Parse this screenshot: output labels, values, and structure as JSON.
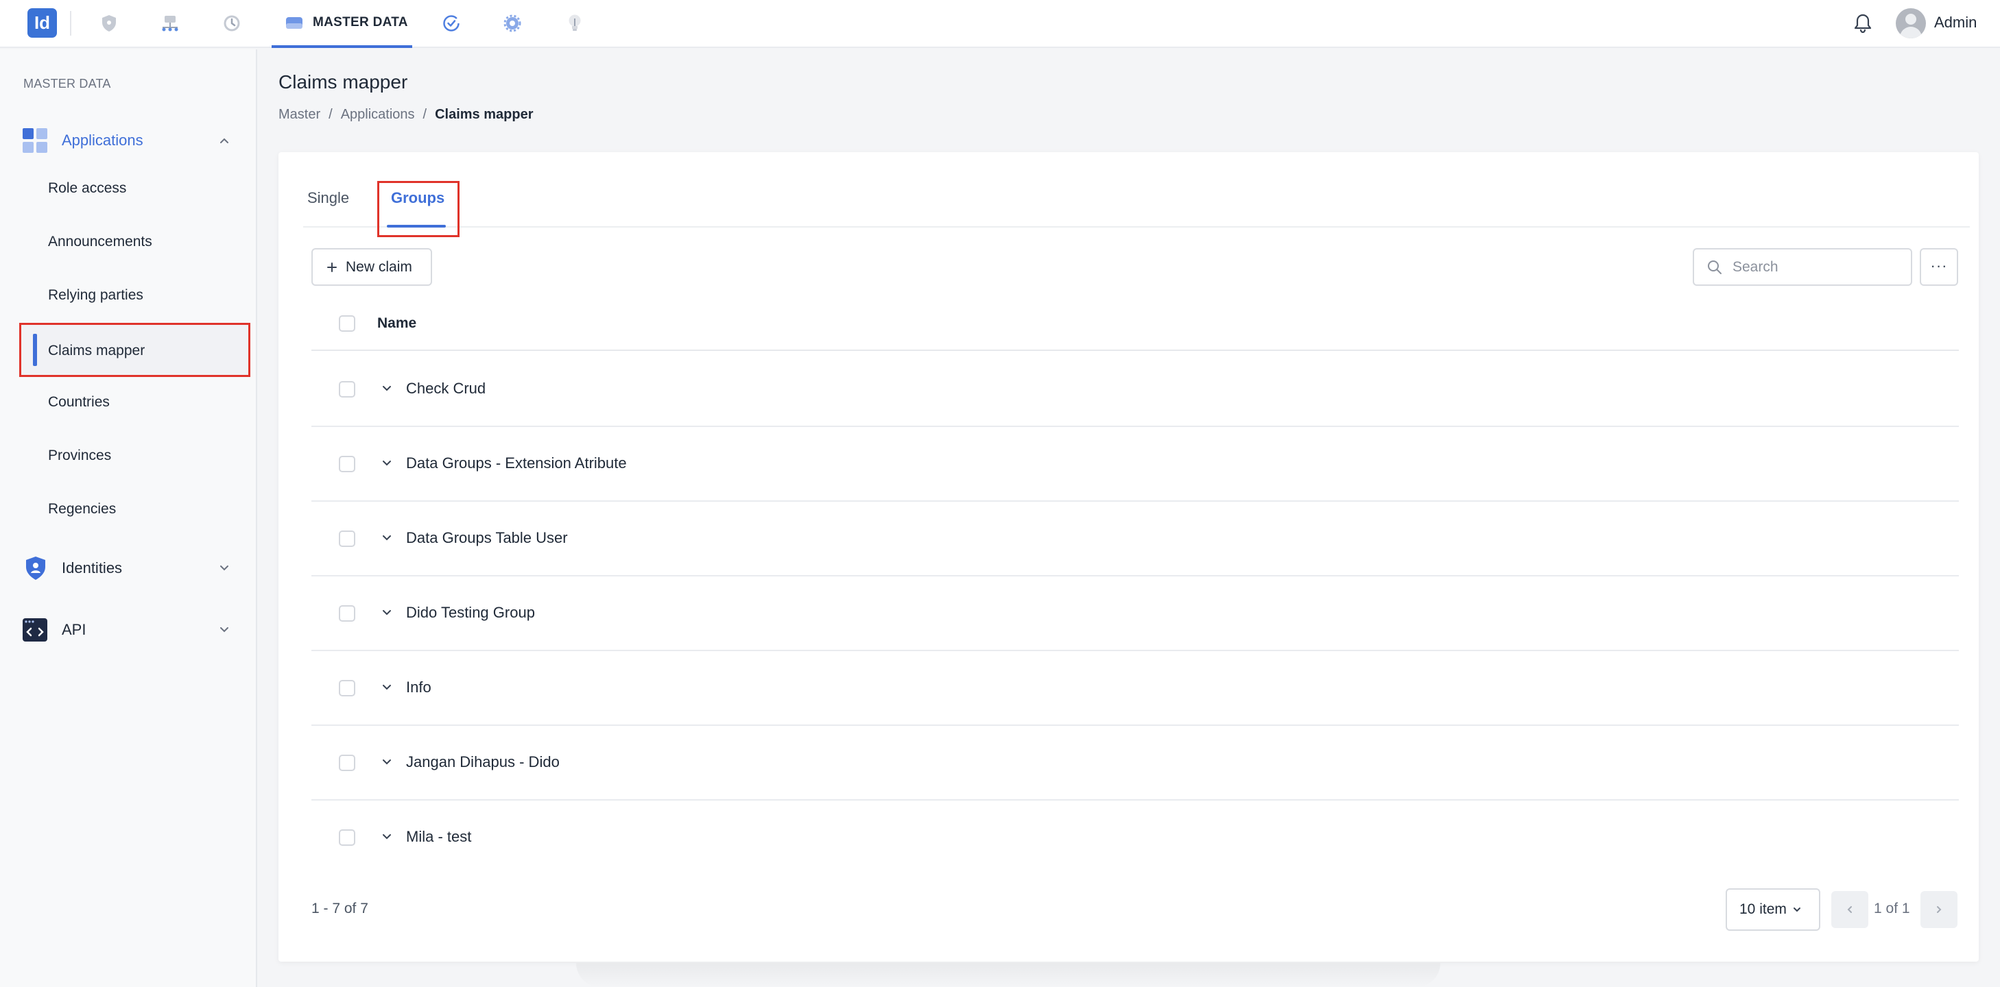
{
  "topbar": {
    "logo_text": "Id",
    "nav_icons": [
      "shield-icon",
      "network-icon",
      "history-icon",
      "master-data-icon",
      "check-circle-icon",
      "gear-icon",
      "lightbulb-icon"
    ],
    "active_tab_label": "MASTER DATA",
    "user_name": "Admin"
  },
  "sidebar": {
    "heading": "MASTER DATA",
    "applications_label": "Applications",
    "items": [
      {
        "label": "Role access"
      },
      {
        "label": "Announcements"
      },
      {
        "label": "Relying parties"
      },
      {
        "label": "Claims mapper"
      },
      {
        "label": "Countries"
      },
      {
        "label": "Provinces"
      },
      {
        "label": "Regencies"
      }
    ],
    "identities_label": "Identities",
    "api_label": "API"
  },
  "main": {
    "title": "Claims mapper",
    "breadcrumb": {
      "c1": "Master",
      "sep": "/",
      "c2": "Applications",
      "c3": "Claims mapper"
    },
    "tabs": {
      "single": "Single",
      "groups": "Groups"
    },
    "new_button_label": "New claim",
    "search_placeholder": "Search",
    "more_label": "···",
    "table": {
      "header_name": "Name",
      "rows": [
        {
          "name": "Check Crud"
        },
        {
          "name": "Data Groups - Extension Atribute"
        },
        {
          "name": "Data Groups Table User"
        },
        {
          "name": "Dido Testing Group"
        },
        {
          "name": "Info"
        },
        {
          "name": "Jangan Dihapus - Dido"
        },
        {
          "name": "Mila - test"
        }
      ]
    },
    "pagination": {
      "range_text": "1 - 7 of 7",
      "page_size": "10 item",
      "page_text": "1 of 1"
    }
  },
  "colors": {
    "accent": "#3f6fd8",
    "highlight": "#e0332a",
    "logo": "#3a72d6"
  }
}
